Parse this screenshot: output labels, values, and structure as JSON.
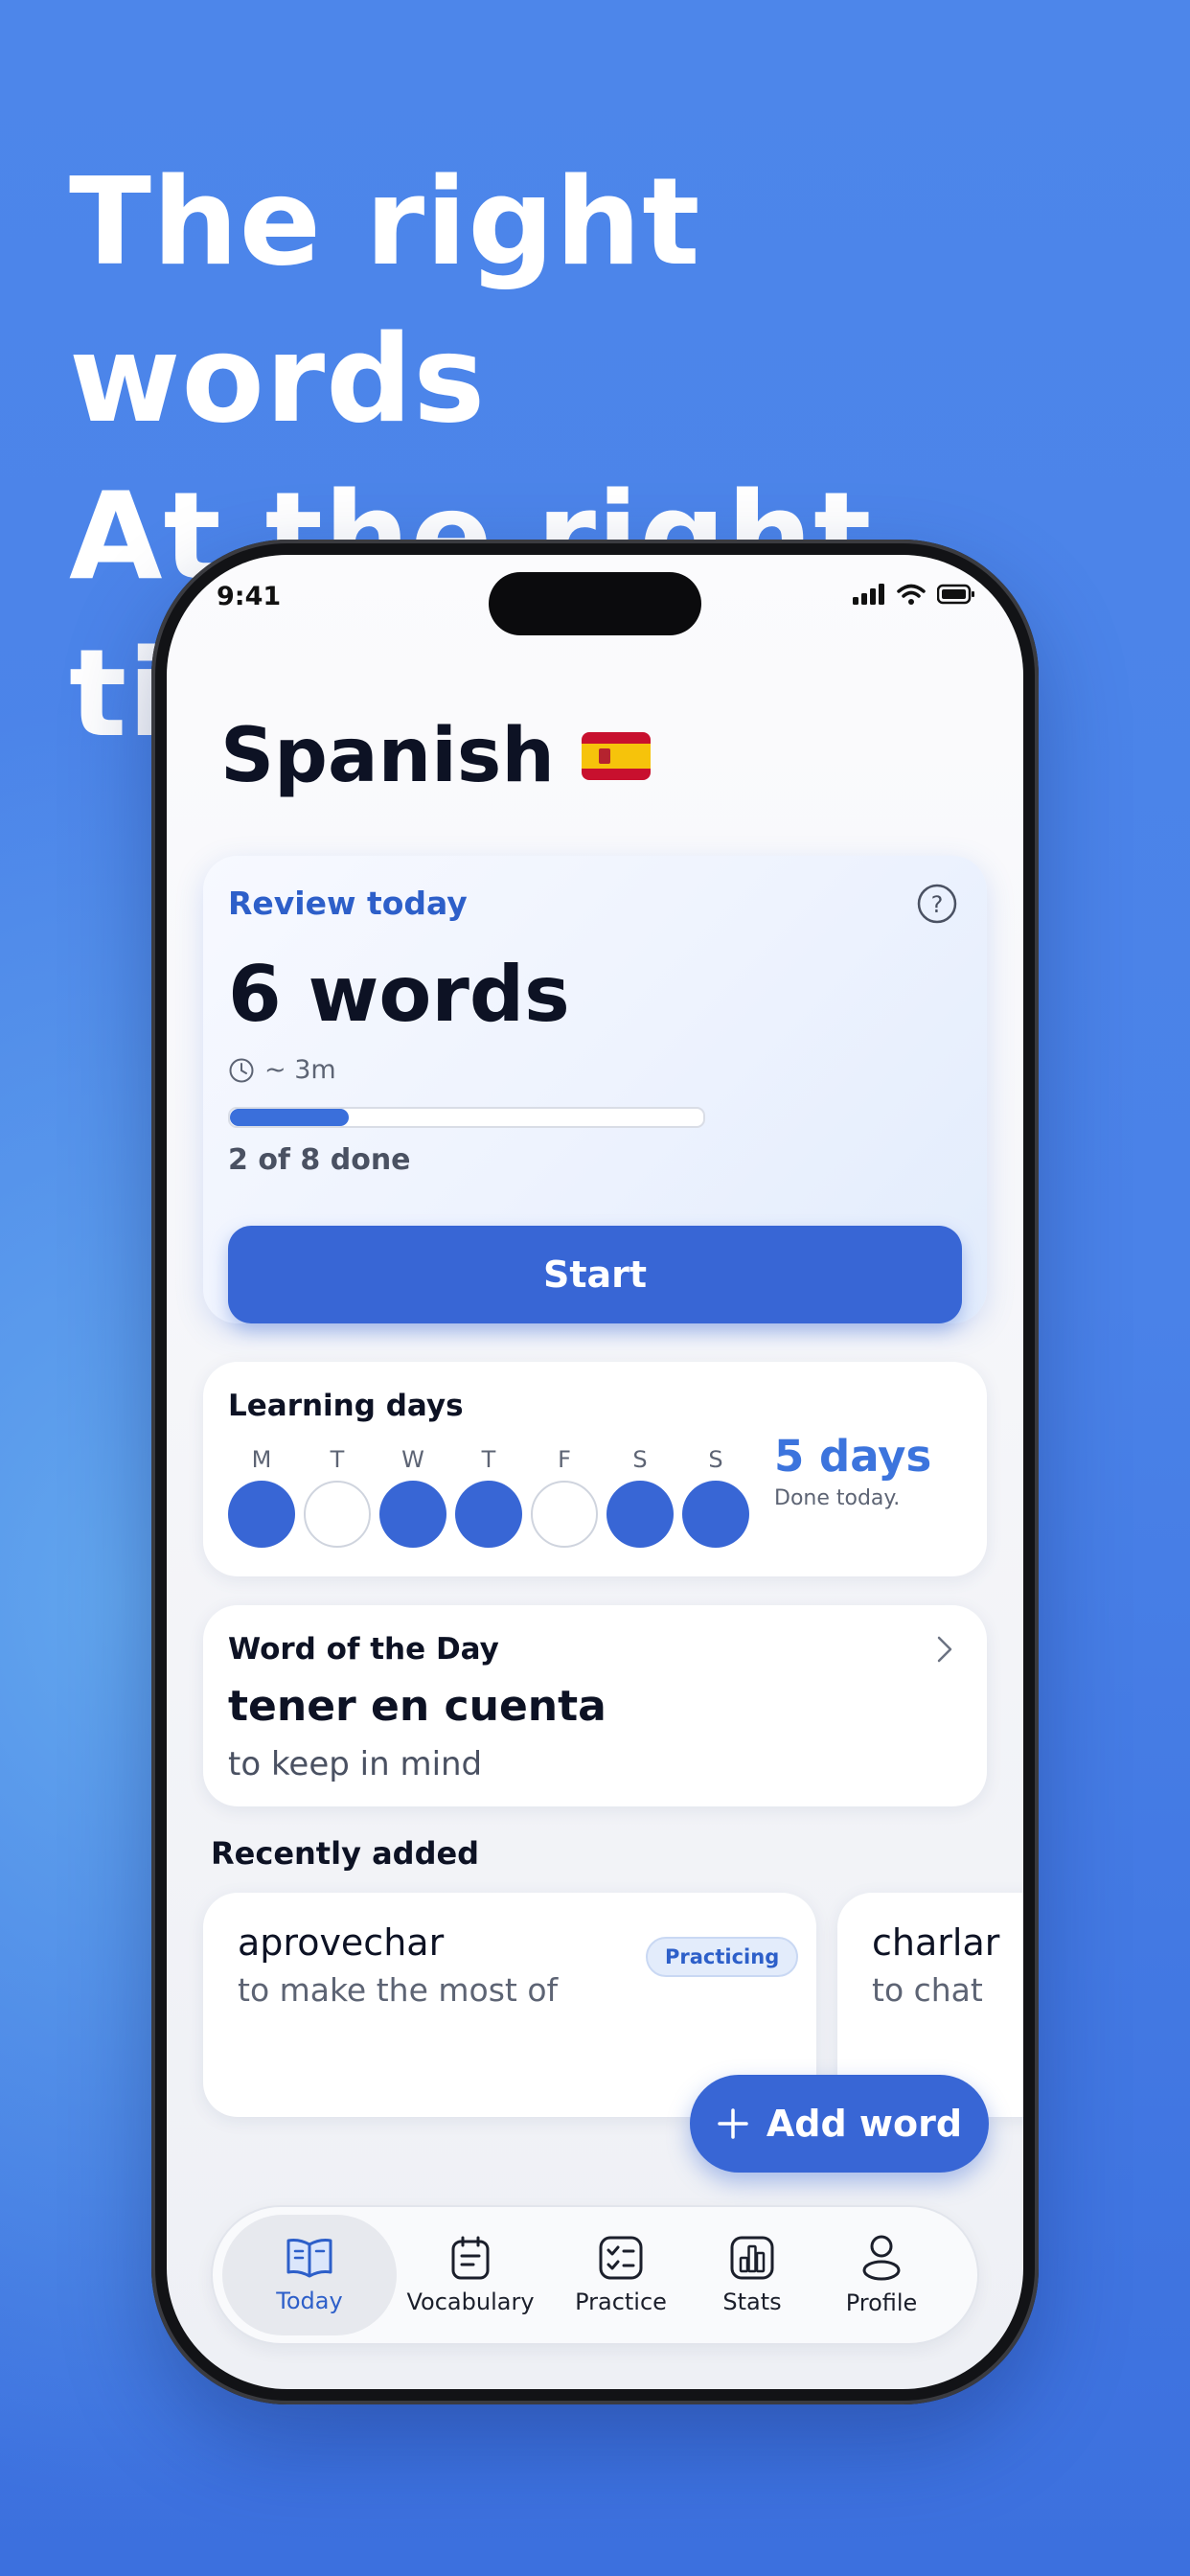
{
  "headline": {
    "line1": "The right words",
    "line2": "At the right time"
  },
  "status_bar": {
    "time": "9:41"
  },
  "header": {
    "title": "Spanish",
    "flag": "🇪🇸"
  },
  "review": {
    "label": "Review today",
    "count": "6 words",
    "time_estimate": "~ 3m",
    "progress": {
      "done": 2,
      "total": 8,
      "text": "2 of 8 done"
    },
    "start_label": "Start"
  },
  "learning_days": {
    "label": "Learning days",
    "days": [
      {
        "letter": "M",
        "done": true
      },
      {
        "letter": "T",
        "done": false
      },
      {
        "letter": "W",
        "done": true
      },
      {
        "letter": "T",
        "done": true
      },
      {
        "letter": "F",
        "done": false
      },
      {
        "letter": "S",
        "done": true
      },
      {
        "letter": "S",
        "done": true
      }
    ],
    "streak": "5 days",
    "streak_note": "Done today."
  },
  "word_of_day": {
    "label": "Word of the Day",
    "word": "tener en cuenta",
    "translation": "to keep in mind"
  },
  "recently_added": {
    "label": "Recently added",
    "items": [
      {
        "word": "aprovechar",
        "translation": "to make the most of",
        "badge": "Practicing"
      },
      {
        "word": "charlar",
        "translation": "to chat"
      }
    ]
  },
  "add_word_label": "Add word",
  "tabs": [
    {
      "label": "Today",
      "icon": "book-open-icon",
      "active": true
    },
    {
      "label": "Vocabulary",
      "icon": "notepad-icon"
    },
    {
      "label": "Practice",
      "icon": "checklist-icon"
    },
    {
      "label": "Stats",
      "icon": "bar-chart-icon"
    },
    {
      "label": "Profile",
      "icon": "person-icon"
    }
  ],
  "colors": {
    "background": "#4a82e8",
    "accent": "#3866d5",
    "accent_text": "#2d5fc9"
  }
}
